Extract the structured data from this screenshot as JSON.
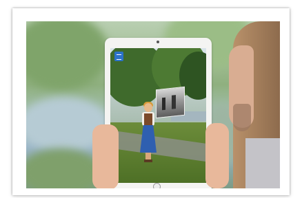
{
  "image": {
    "alt": "",
    "frame_color": "#ffffff",
    "accent": "#2b72c9"
  },
  "icons": {
    "app_badge": "app-badge-icon"
  }
}
